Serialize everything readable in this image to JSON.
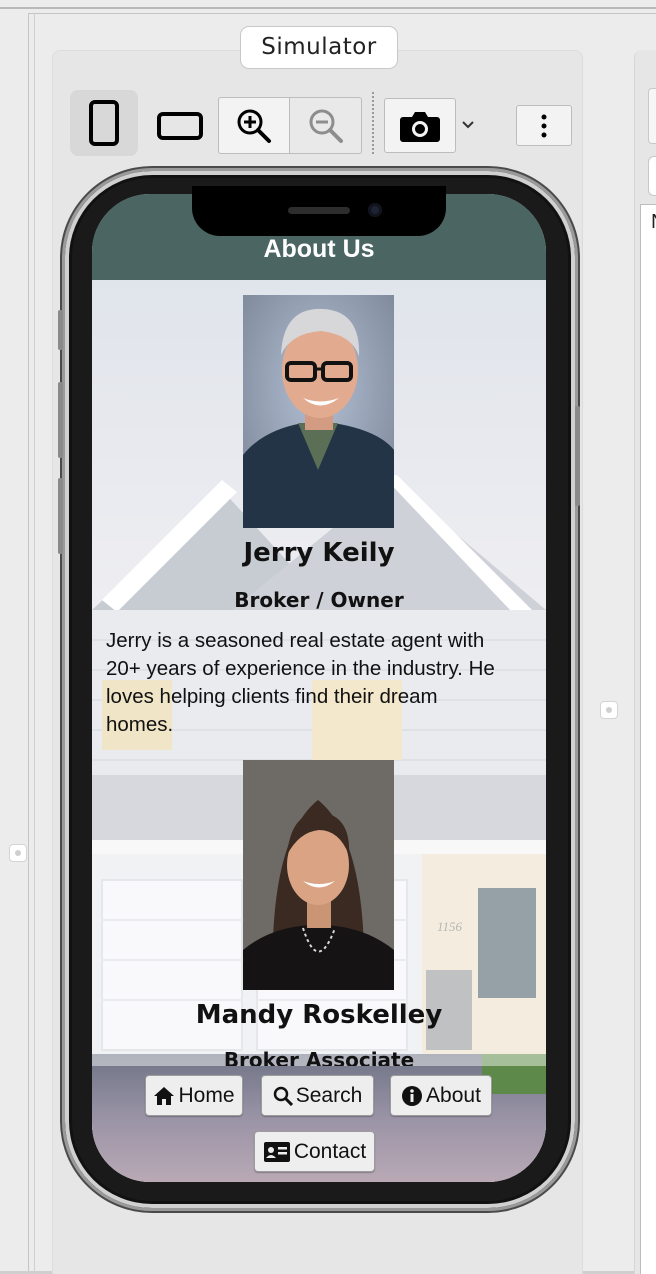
{
  "simulator": {
    "title": "Simulator",
    "toolbar": {
      "portrait_icon": "phone-portrait-icon",
      "landscape_icon": "phone-landscape-icon",
      "zoom_in_icon": "zoom-in-icon",
      "zoom_out_icon": "zoom-out-icon",
      "screenshot_icon": "camera-icon",
      "more_icon": "more-vertical-icon"
    }
  },
  "right_panel": {
    "list_text": "N"
  },
  "app": {
    "header_title": "About Us",
    "people": [
      {
        "name": "Jerry Keily",
        "role": "Broker / Owner",
        "bio": "Jerry is a seasoned real estate agent with 20+ years of experience in the industry. He loves helping clients find their dream homes."
      },
      {
        "name": "Mandy Roskelley",
        "role": "Broker Associate"
      }
    ],
    "house_number": "1156",
    "nav": {
      "home": "Home",
      "search": "Search",
      "about": "About",
      "contact": "Contact"
    }
  },
  "colors": {
    "header_bg": "#4a6562",
    "window_bg": "#ececec"
  }
}
